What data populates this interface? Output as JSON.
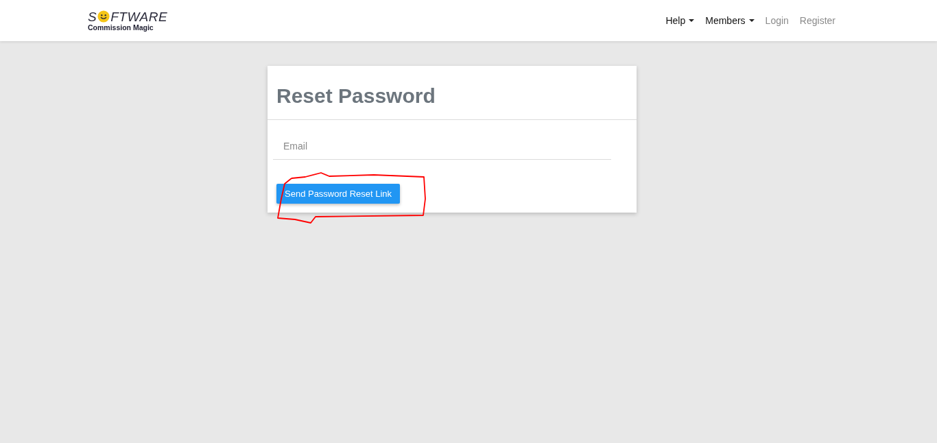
{
  "logo": {
    "before": "S",
    "after": "FTWARE",
    "tagline": "Commission Magic"
  },
  "nav": [
    {
      "label": "Help",
      "kind": "dropdown"
    },
    {
      "label": "Members",
      "kind": "dropdown"
    },
    {
      "label": "Login",
      "kind": "link"
    },
    {
      "label": "Register",
      "kind": "link"
    }
  ],
  "card": {
    "title": "Reset Password",
    "email": {
      "placeholder": "Email"
    },
    "button": "Send Password Reset Link"
  }
}
